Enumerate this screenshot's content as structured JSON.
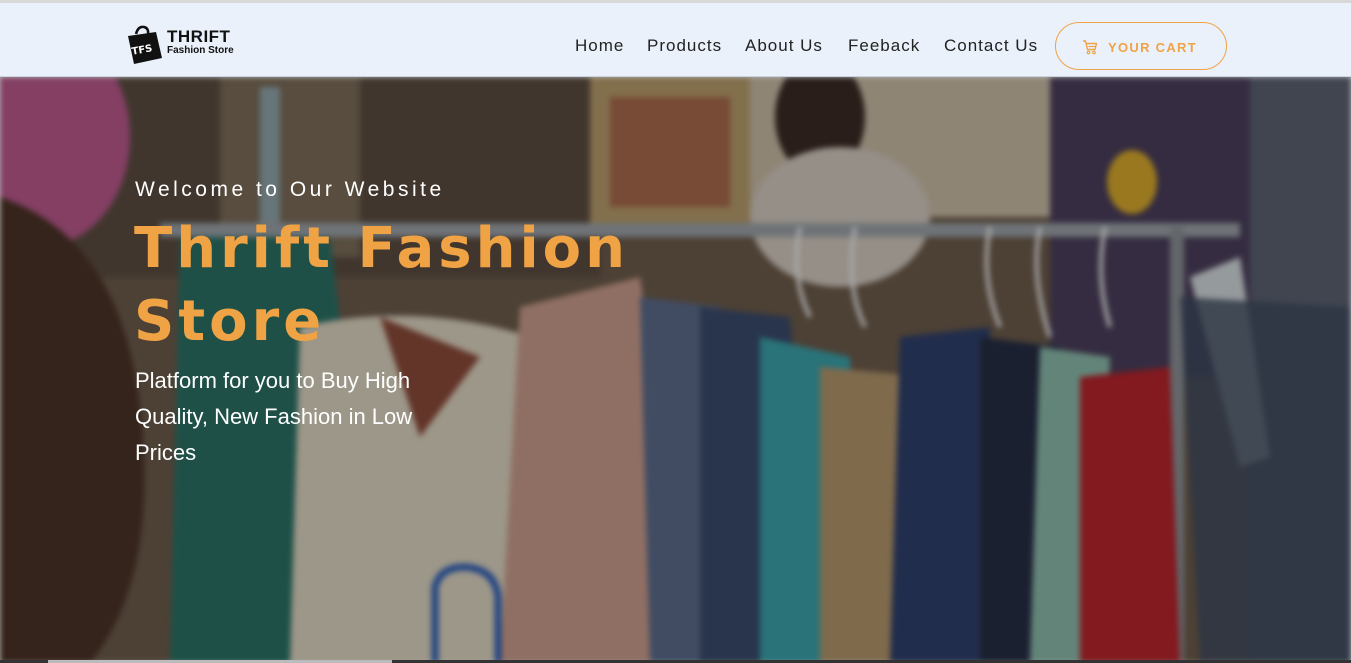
{
  "brand": {
    "logo_initials": "TFS",
    "name_line1": "THRIFT",
    "name_line2": "Fashion Store"
  },
  "nav": {
    "items": [
      "Home",
      "Products",
      "About Us",
      "Feeback",
      "Contact Us"
    ],
    "cart_label": "YOUR CART",
    "cart_icon": "shopping-cart-icon"
  },
  "hero": {
    "welcome": "Welcome to Our Website",
    "title": "Thrift Fashion Store",
    "subtitle": "Platform for you to Buy High Quality, New Fashion in Low Prices",
    "background_description_icon": "clothing-rack-photo"
  },
  "colors": {
    "accent": "#f0a344",
    "navbar_bg": "#eaf1fa",
    "nav_text": "#222222",
    "hero_text": "#ffffff"
  }
}
